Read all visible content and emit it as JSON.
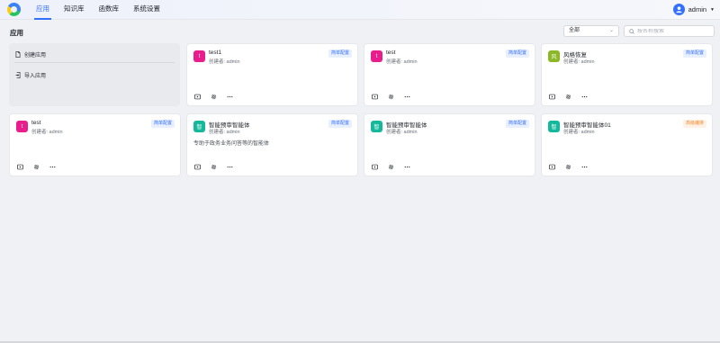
{
  "nav": {
    "items": [
      {
        "label": "应用",
        "active": true
      },
      {
        "label": "知识库",
        "active": false
      },
      {
        "label": "函数库",
        "active": false
      },
      {
        "label": "系统设置",
        "active": false
      }
    ]
  },
  "user": {
    "name": "admin"
  },
  "page": {
    "title": "应用"
  },
  "filter": {
    "selected": "全部"
  },
  "search": {
    "placeholder": "按名称搜索",
    "value": ""
  },
  "create": {
    "create_label": "创建应用",
    "import_label": "导入应用"
  },
  "apps": [
    {
      "name": "test1",
      "initial": "t",
      "color": "#e91e8c",
      "creator": "创建者: admin",
      "badge": "简单配置",
      "badge_type": "blue",
      "desc": ""
    },
    {
      "name": "test",
      "initial": "t",
      "color": "#e91e8c",
      "creator": "创建者: admin",
      "badge": "简单配置",
      "badge_type": "blue",
      "desc": ""
    },
    {
      "name": "风格恢复",
      "initial": "风",
      "color": "#8bb826",
      "creator": "创建者: admin",
      "badge": "简单配置",
      "badge_type": "blue",
      "desc": ""
    },
    {
      "name": "test",
      "initial": "t",
      "color": "#e91e8c",
      "creator": "创建者: admin",
      "badge": "简单配置",
      "badge_type": "blue",
      "desc": ""
    },
    {
      "name": "智能预审智能体",
      "initial": "智",
      "color": "#14b89a",
      "creator": "创建者: admin",
      "badge": "简单配置",
      "badge_type": "blue",
      "desc": "专助于政务业务问答等的智能体"
    },
    {
      "name": "智能预审智能体",
      "initial": "智",
      "color": "#14b89a",
      "creator": "创建者: admin",
      "badge": "简单配置",
      "badge_type": "blue",
      "desc": ""
    },
    {
      "name": "智能预审智能体01",
      "initial": "智",
      "color": "#14b89a",
      "creator": "创建者: admin",
      "badge": "高级编排",
      "badge_type": "orange",
      "desc": ""
    }
  ],
  "icons": {
    "play": "play-icon",
    "settings": "gear-icon",
    "more": "more-icon"
  }
}
